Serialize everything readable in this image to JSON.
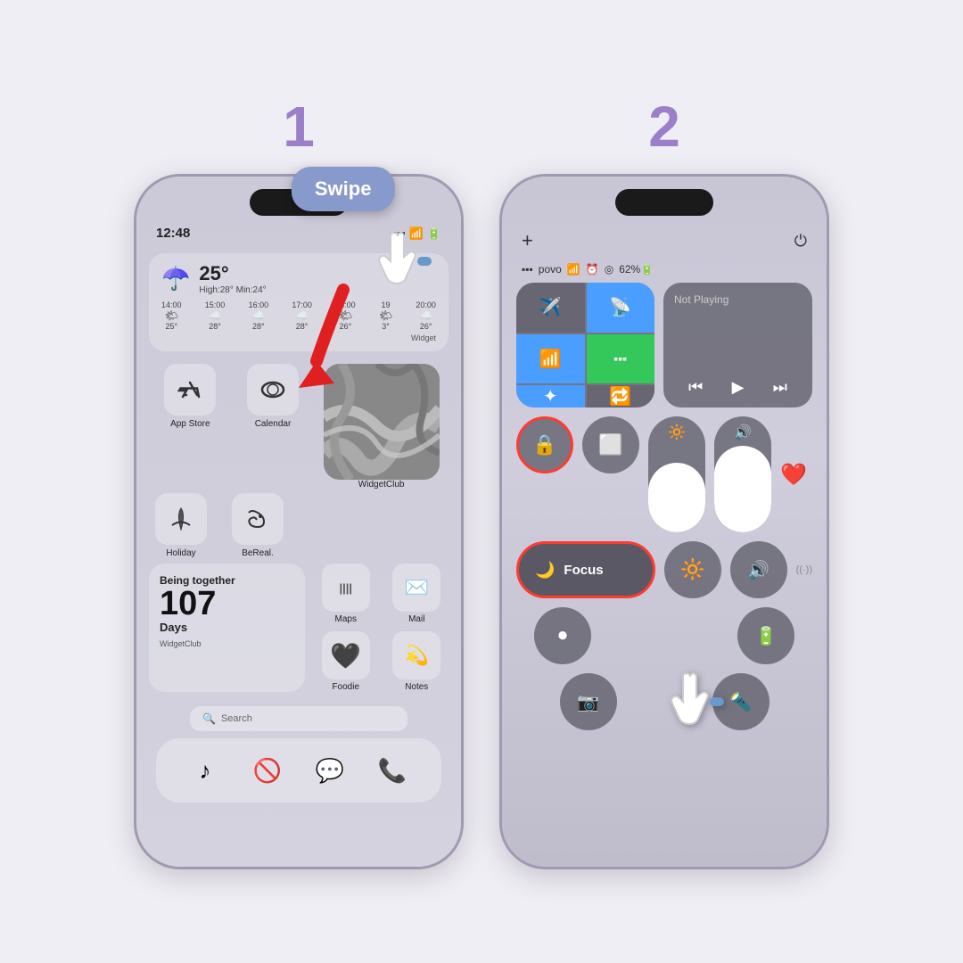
{
  "page": {
    "background": "#f0eef5"
  },
  "step1": {
    "number": "1",
    "swipe_label": "Swipe",
    "phone": {
      "time": "12:48",
      "weather": {
        "temp": "25°",
        "highlow": "High:28° Min:24°",
        "hours": [
          "14:00",
          "15:00",
          "16:00",
          "17:00",
          "18:00",
          "19",
          "20:00"
        ],
        "temps": [
          "25°",
          "28°",
          "28°",
          "28°",
          "26°",
          "3°",
          "26°"
        ]
      },
      "widget_label": "Widget",
      "apps_row1": [
        {
          "label": "App Store",
          "icon": "🤍"
        },
        {
          "label": "Calendar",
          "icon": "⭕"
        }
      ],
      "apps_row2": [
        {
          "label": "Holiday",
          "icon": "🌙"
        },
        {
          "label": "BeReal.",
          "icon": "🦋"
        }
      ],
      "widget_club_label": "WidgetClub",
      "together_text": "Being together",
      "days_num": "107",
      "days_label": "Days",
      "widget_club_bottom": "WidgetClub",
      "mini_apps": [
        {
          "label": "Maps",
          "icon": "////"
        },
        {
          "label": "Mail",
          "icon": "✉️"
        },
        {
          "label": "Foodie",
          "icon": "🖤"
        },
        {
          "label": "Notes",
          "icon": "💫"
        }
      ],
      "search_placeholder": "Search",
      "dock_icons": [
        "♪",
        "🚫",
        "💬",
        "📞"
      ]
    }
  },
  "step2": {
    "number": "2",
    "phone": {
      "plus": "+",
      "power": "⏻",
      "status": "▪▪▪ povo  ⌾  62%",
      "not_playing": "Not Playing",
      "focus_label": "Focus",
      "media_controls": [
        "⏮",
        "▶",
        "⏭"
      ]
    }
  }
}
